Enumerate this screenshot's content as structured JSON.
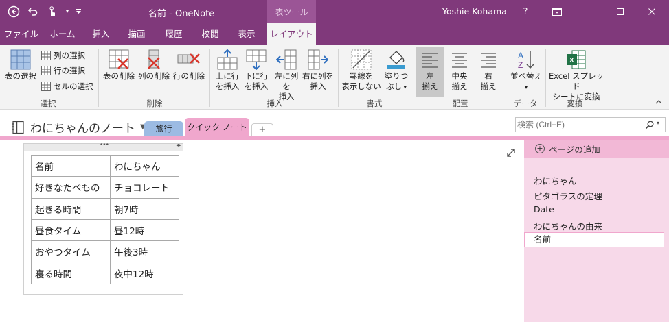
{
  "window": {
    "title": "名前 - OneNote",
    "tool_context": "表ツール",
    "user": "Yoshie Kohama",
    "help": "?"
  },
  "tabs": [
    "ファイル",
    "ホーム",
    "挿入",
    "描画",
    "履歴",
    "校閲",
    "表示",
    "レイアウト"
  ],
  "ribbon": {
    "select_table": "表の選択",
    "select_column": "列の選択",
    "select_row": "行の選択",
    "select_cell": "セルの選択",
    "group_select": "選択",
    "delete_table": "表の削除",
    "delete_column": "列の削除",
    "delete_row": "行の削除",
    "group_delete": "削除",
    "insert_above_1": "上に行",
    "insert_above_2": "を挿入",
    "insert_below_1": "下に行",
    "insert_below_2": "を挿入",
    "insert_left_1": "左に列を",
    "insert_left_2": "挿入",
    "insert_right_1": "右に列を",
    "insert_right_2": "挿入",
    "group_insert": "挿入",
    "hide_borders_1": "罫線を",
    "hide_borders_2": "表示しない",
    "shading_1": "塗りつ",
    "shading_2": "ぶし",
    "group_format": "書式",
    "align_left_1": "左",
    "align_left_2": "揃え",
    "align_center_1": "中央",
    "align_center_2": "揃え",
    "align_right_1": "右",
    "align_right_2": "揃え",
    "group_align": "配置",
    "sort": "並べ替え",
    "group_data": "データ",
    "excel_1": "Excel スプレッド",
    "excel_2": "シートに変換",
    "group_convert": "変換"
  },
  "notebook": {
    "name": "わにちゃんのノート",
    "sections": [
      "旅行",
      "クイック ノート"
    ],
    "add_section": "+",
    "search_placeholder": "検索 (Ctrl+E)"
  },
  "table": {
    "rows": [
      [
        "名前",
        "わにちゃん"
      ],
      [
        "好きなたべもの",
        "チョコレート"
      ],
      [
        "起きる時間",
        "朝7時"
      ],
      [
        "昼食タイム",
        "昼12時"
      ],
      [
        "おやつタイム",
        "午後3時"
      ],
      [
        "寝る時間",
        "夜中12時"
      ]
    ]
  },
  "pages": {
    "add_page": "ページの追加",
    "items": [
      "わにちゃん",
      "ピタゴラスの定理",
      "Date",
      "わにちゃんの由来",
      "名前"
    ],
    "selected": "名前"
  },
  "colors": {
    "brand": "#80397b",
    "section_travel": "#8fb3e0",
    "section_quick": "#f0a7cd",
    "page_list_bg": "#f7d9e9"
  }
}
